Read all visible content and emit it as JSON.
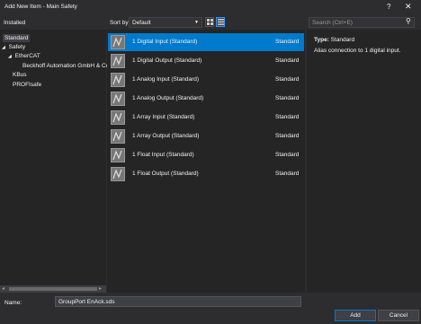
{
  "window": {
    "title": "Add New Item - Main Safety",
    "help_glyph": "?",
    "close_glyph": "✕"
  },
  "left": {
    "header": "Installed",
    "tree": [
      {
        "label": "Standard",
        "selected": true,
        "arrow": ""
      },
      {
        "label": "Safety",
        "arrow": "◢"
      },
      {
        "label": "EtherCAT",
        "arrow": "◢"
      },
      {
        "label": "Beckhoff Automation GmbH & Co",
        "arrow": ""
      },
      {
        "label": "KBus",
        "arrow": ""
      },
      {
        "label": "PROFIsafe",
        "arrow": ""
      }
    ]
  },
  "toolbar": {
    "sort_label": "Sort by:",
    "sort_value": "Default",
    "search_placeholder": "Search (Ctrl+E)"
  },
  "items": [
    {
      "name": "1 Digital Input (Standard)",
      "category": "Standard",
      "selected": true
    },
    {
      "name": "1 Digital Output (Standard)",
      "category": "Standard"
    },
    {
      "name": "1 Analog Input (Standard)",
      "category": "Standard"
    },
    {
      "name": "1 Analog Output (Standard)",
      "category": "Standard"
    },
    {
      "name": "1 Array Input (Standard)",
      "category": "Standard"
    },
    {
      "name": "1 Array Output (Standard)",
      "category": "Standard"
    },
    {
      "name": "1 Float Input (Standard)",
      "category": "Standard"
    },
    {
      "name": "1 Float Output (Standard)",
      "category": "Standard"
    }
  ],
  "description": {
    "type_label": "Type:",
    "type_value": "Standard",
    "text": "Alias connection to 1 digital input."
  },
  "bottom": {
    "name_label": "Name:",
    "name_value": "GroupPort EnAck.sds",
    "add_label": "Add",
    "cancel_label": "Cancel"
  },
  "colors": {
    "background": "#2d2d30",
    "panel": "#252526",
    "selection": "#007acc"
  }
}
